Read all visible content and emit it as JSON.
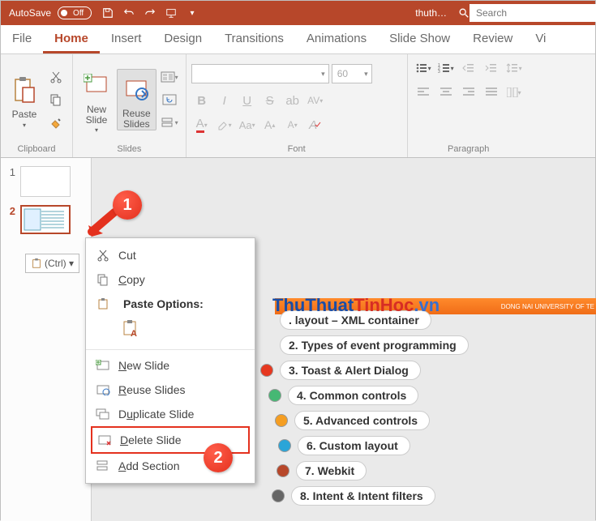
{
  "titlebar": {
    "autosave_label": "AutoSave",
    "autosave_state": "Off",
    "doc_name": "thuth…"
  },
  "search": {
    "placeholder": "Search"
  },
  "tabs": [
    "File",
    "Home",
    "Insert",
    "Design",
    "Transitions",
    "Animations",
    "Slide Show",
    "Review",
    "Vi"
  ],
  "active_tab_index": 1,
  "ribbon": {
    "clipboard": {
      "label": "Clipboard",
      "paste": "Paste"
    },
    "slides": {
      "label": "Slides",
      "new_slide": "New\nSlide",
      "reuse": "Reuse\nSlides"
    },
    "font": {
      "label": "Font",
      "size_value": "60"
    },
    "paragraph": {
      "label": "Paragraph"
    }
  },
  "thumbs": {
    "items": [
      {
        "num": "1"
      },
      {
        "num": "2"
      }
    ],
    "selected_index": 1,
    "paste_chip": "(Ctrl) ▾"
  },
  "context_menu": {
    "cut": "Cut",
    "copy": "Copy",
    "paste_options_label": "Paste Options:",
    "new_slide": "New Slide",
    "reuse_slides": "Reuse Slides",
    "duplicate_slide": "Duplicate Slide",
    "delete_slide": "Delete Slide",
    "add_section": "Add Section"
  },
  "callouts": {
    "one": "1",
    "two": "2"
  },
  "banner_text": "DONG NAI UNIVERSITY OF TE",
  "topics": [
    {
      "color": "#2aa5d8",
      "text": ". layout – XML container"
    },
    {
      "color": "#2aa5d8",
      "text": "2. Types of event programming"
    },
    {
      "color": "#e63820",
      "text": "3. Toast & Alert Dialog"
    },
    {
      "color": "#46b874",
      "text": "4. Common controls"
    },
    {
      "color": "#f59e22",
      "text": "5. Advanced controls"
    },
    {
      "color": "#2aa5d8",
      "text": "6. Custom layout"
    },
    {
      "color": "#b7472a",
      "text": "7. Webkit"
    },
    {
      "color": "#666",
      "text": "8. Intent & Intent filters"
    }
  ],
  "watermark": {
    "p1": "ThuThuat",
    "p2": "TinHoc",
    "p3": ".vn"
  }
}
